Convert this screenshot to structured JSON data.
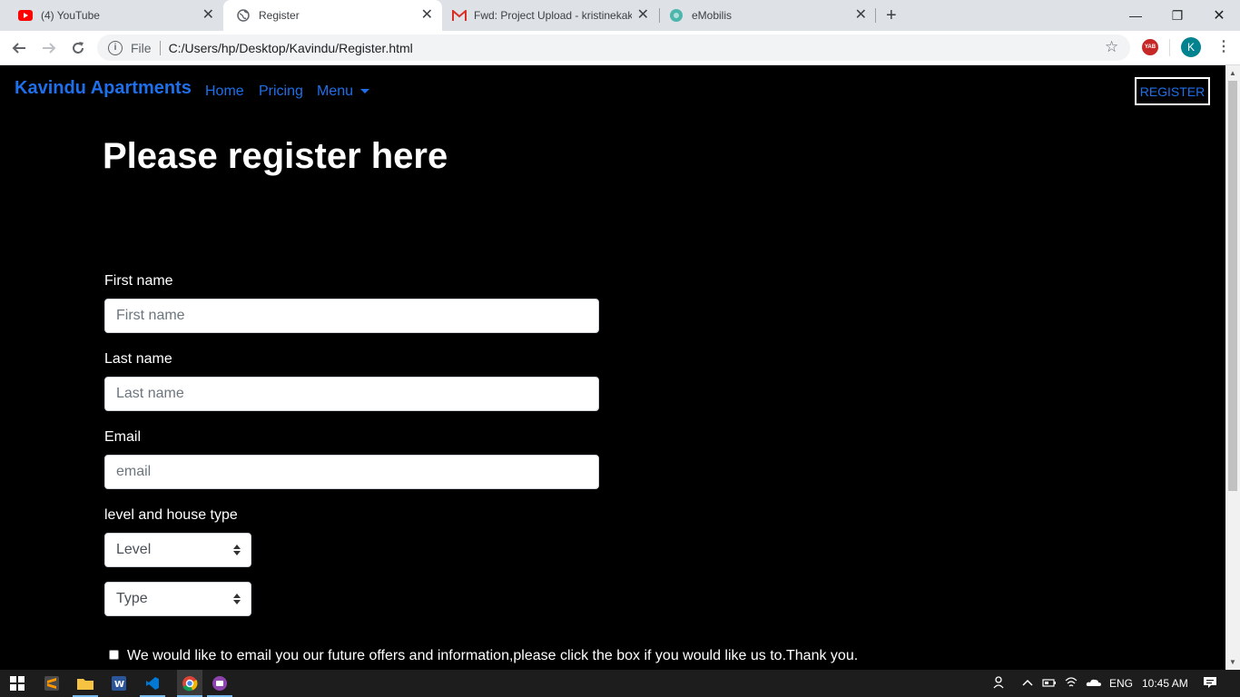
{
  "browser": {
    "tabs": [
      {
        "title": "(4) YouTube",
        "icon": "youtube-icon",
        "active": false
      },
      {
        "title": "Register",
        "icon": "globe-icon",
        "active": true
      },
      {
        "title": "Fwd: Project Upload - kristinekak",
        "icon": "gmail-icon",
        "active": false
      },
      {
        "title": "eMobilis",
        "icon": "emobilis-icon",
        "active": false
      }
    ],
    "file_label": "File",
    "url": "C:/Users/hp/Desktop/Kavindu/Register.html",
    "extension_label": "YAB",
    "profile_initial": "K"
  },
  "navbar": {
    "brand": "Kavindu Apartments",
    "links": [
      "Home",
      "Pricing",
      "Menu"
    ],
    "register_label": "REGISTER"
  },
  "form": {
    "heading": "Please register here",
    "first_name_label": "First name",
    "first_name_placeholder": "First name",
    "last_name_label": "Last name",
    "last_name_placeholder": "Last name",
    "email_label": "Email",
    "email_placeholder": "email",
    "level_type_label": "level and house type",
    "level_select_value": "Level",
    "type_select_value": "Type",
    "checkbox_label": "We would like to email you our future offers and information,please click the box if you would like us to.Thank you."
  },
  "taskbar": {
    "language": "ENG",
    "time": "10:45 AM"
  },
  "colors": {
    "link_blue": "#1f6feb",
    "page_bg": "#000000"
  }
}
